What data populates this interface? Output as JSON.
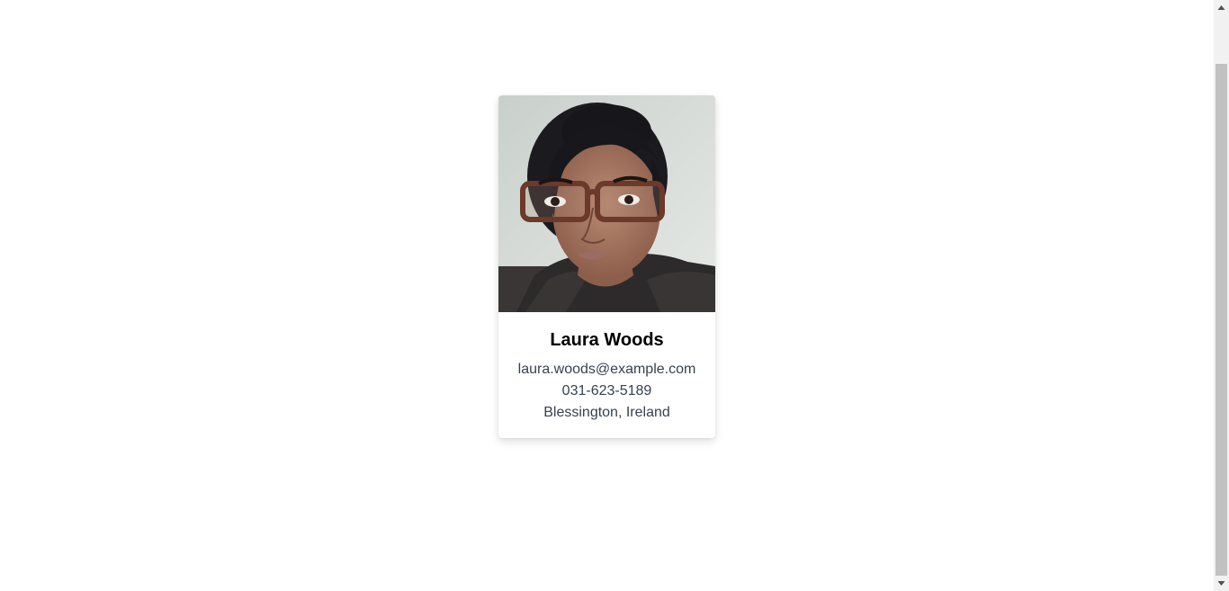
{
  "profile": {
    "name": "Laura Woods",
    "email": "laura.woods@example.com",
    "phone": "031-623-5189",
    "location": "Blessington, Ireland",
    "photo_alt": "Laura Woods"
  },
  "colors": {
    "page_background": "#ffffff",
    "card_background": "#ffffff",
    "name_text": "#000000",
    "info_text": "#374151",
    "scrollbar_track": "#f1f1f1",
    "scrollbar_thumb": "#c1c1c1"
  },
  "icons": {
    "scroll_up": "triangle-up-icon",
    "scroll_down": "triangle-down-icon"
  }
}
